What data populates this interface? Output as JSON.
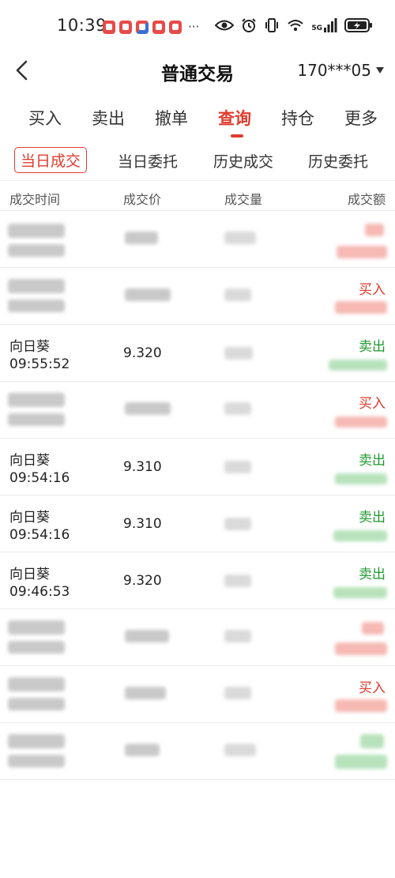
{
  "status_bar": {
    "time": "10:39",
    "dots": "···",
    "network": "5G"
  },
  "header": {
    "title": "普通交易",
    "account": "170***05"
  },
  "tabs": [
    "买入",
    "卖出",
    "撤单",
    "查询",
    "持仓",
    "更多"
  ],
  "active_tab": "查询",
  "subtabs": [
    "当日成交",
    "当日委托",
    "历史成交",
    "历史委托"
  ],
  "active_subtab": "当日成交",
  "columns": [
    "成交时间",
    "成交价",
    "成交量",
    "成交额"
  ],
  "rows": [
    {
      "name": null,
      "time": null,
      "price": null,
      "direction": null,
      "dir_type": "buy"
    },
    {
      "name": null,
      "time": null,
      "price": null,
      "direction": "买入",
      "dir_type": "buy"
    },
    {
      "name": "向日葵",
      "time": "09:55:52",
      "price": "9.320",
      "direction": "卖出",
      "dir_type": "sell"
    },
    {
      "name": null,
      "time": null,
      "price": null,
      "direction": "买入",
      "dir_type": "buy"
    },
    {
      "name": "向日葵",
      "time": "09:54:16",
      "price": "9.310",
      "direction": "卖出",
      "dir_type": "sell"
    },
    {
      "name": "向日葵",
      "time": "09:54:16",
      "price": "9.310",
      "direction": "卖出",
      "dir_type": "sell"
    },
    {
      "name": "向日葵",
      "time": "09:46:53",
      "price": "9.320",
      "direction": "卖出",
      "dir_type": "sell"
    },
    {
      "name": null,
      "time": null,
      "price": null,
      "direction": null,
      "dir_type": "buy"
    },
    {
      "name": null,
      "time": null,
      "price": null,
      "direction": "买入",
      "dir_type": "buy"
    },
    {
      "name": null,
      "time": null,
      "price": null,
      "direction": null,
      "dir_type": "sell"
    }
  ],
  "colors": {
    "accent_red": "#e03b2d",
    "sell_green": "#1f9a2f",
    "divider": "#ececec"
  },
  "icons": [
    "back-chevron-icon",
    "caret-down-icon",
    "eye-icon",
    "alarm-icon",
    "vibrate-icon",
    "wifi-icon",
    "signal-icon",
    "battery-charging-icon"
  ]
}
